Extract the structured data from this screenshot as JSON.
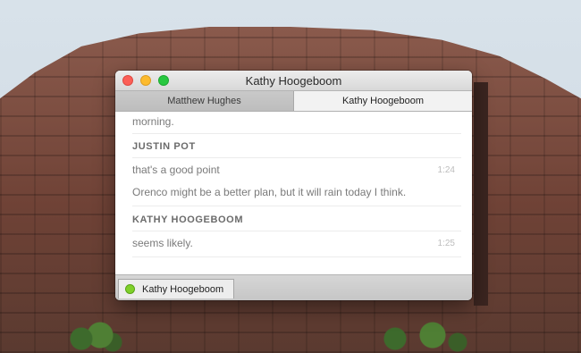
{
  "window": {
    "title": "Kathy Hoogeboom"
  },
  "tabs": [
    {
      "label": "Matthew Hughes",
      "active": false
    },
    {
      "label": "Kathy Hoogeboom",
      "active": true
    }
  ],
  "messages": {
    "partial_top": "morning.",
    "groups": [
      {
        "sender": "JUSTIN POT",
        "lines": [
          {
            "text": "that's a good point",
            "time": "1:24"
          },
          {
            "text": "Orenco might be a better plan, but it will rain today I think.",
            "time": ""
          }
        ]
      },
      {
        "sender": "KATHY HOOGEBOOM",
        "lines": [
          {
            "text": "seems likely.",
            "time": "1:25"
          }
        ]
      }
    ]
  },
  "bottom_tab": {
    "label": "Kathy Hoogeboom",
    "status": "online",
    "status_color": "#7fd02a"
  }
}
